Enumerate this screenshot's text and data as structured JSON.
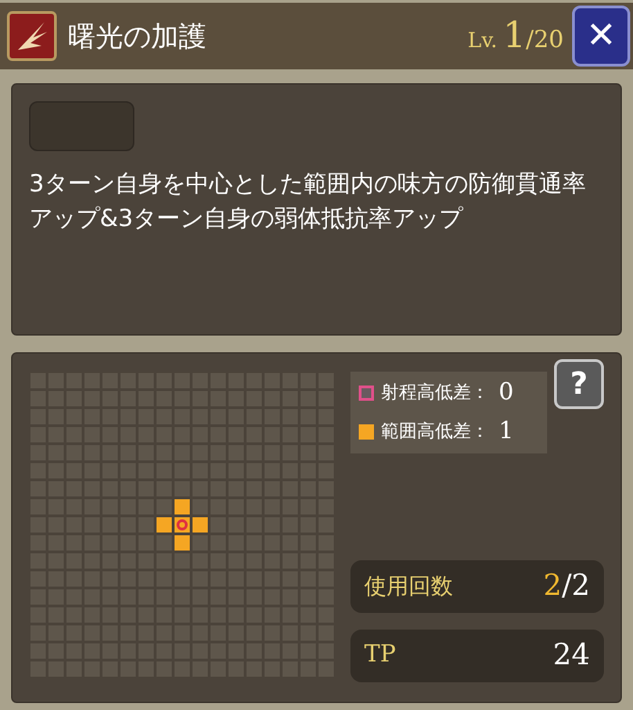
{
  "header": {
    "title": "曙光の加護",
    "level_label": "Lv.",
    "level": "1",
    "level_max": "/20",
    "close": "✕"
  },
  "skill": {
    "description": "3ターン自身を中心とした範囲内の味方の防御貫通率アップ&3ターン自身の弱体抵抗率アップ"
  },
  "legend": [
    {
      "label": "射程高低差：",
      "value": "0",
      "color": "#e0508a",
      "kind": "outline"
    },
    {
      "label": "範囲高低差：",
      "value": "1",
      "color": "#f5a623",
      "kind": "filled"
    }
  ],
  "help": "?",
  "uses": {
    "label": "使用回数",
    "current": "2",
    "max": "/2"
  },
  "tp": {
    "label": "TP",
    "value": "24"
  }
}
